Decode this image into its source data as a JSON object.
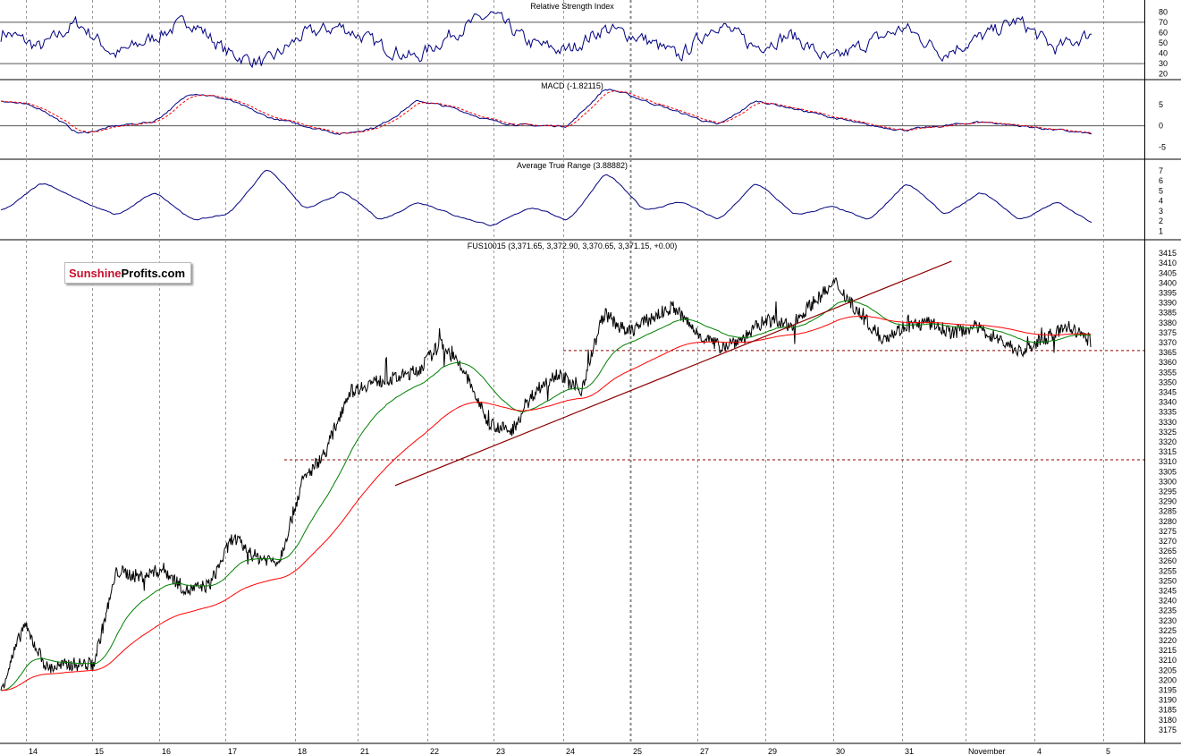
{
  "logo": {
    "part1": "Sunshine",
    "part2": "Profits.com"
  },
  "colors": {
    "price": "#000000",
    "ema_fast": "#008000",
    "ema_slow": "#ff0000",
    "indicator": "#000080",
    "macd_signal": "#ff0000",
    "trend": "#8b0000",
    "grid": "#9a9a9a"
  },
  "chart_data": [
    {
      "type": "line",
      "title": "Relative Strength Index",
      "yticks": [
        20,
        30,
        40,
        50,
        60,
        70,
        80
      ],
      "ylim": [
        18,
        88
      ],
      "reference_lines": [
        30,
        70
      ],
      "pattern": [
        62,
        45,
        70,
        38,
        55,
        72,
        40,
        30,
        58,
        66,
        48,
        35,
        60,
        78,
        50,
        42,
        64,
        55,
        36,
        70,
        46,
        58,
        32,
        50,
        65,
        40,
        55,
        72,
        44,
        60
      ]
    },
    {
      "type": "line",
      "title": "MACD (-1.82115)",
      "yticks": [
        -5,
        0,
        5
      ],
      "ylim": [
        -7,
        10
      ],
      "zero_line": 0,
      "pattern": [
        6,
        4,
        -2,
        0,
        1,
        8,
        6,
        2,
        0,
        -2,
        0,
        6,
        4,
        1,
        0,
        0,
        9,
        6,
        3,
        0,
        6,
        4,
        2,
        0,
        -1,
        0,
        1,
        0,
        -1,
        -2
      ]
    },
    {
      "type": "line",
      "title": "Average True Range (3.88882)",
      "yticks": [
        1,
        2,
        3,
        4,
        5,
        6,
        7
      ],
      "ylim": [
        0.5,
        7.8
      ],
      "pattern": [
        3,
        6,
        4,
        2.5,
        5,
        2,
        2.8,
        7.5,
        3,
        5,
        2,
        4,
        2.5,
        1.5,
        3.5,
        2,
        7,
        3,
        4,
        2,
        6,
        2.5,
        3.5,
        2,
        6,
        2.5,
        5,
        2,
        4,
        1.5
      ]
    },
    {
      "type": "line",
      "title": "FUS10015 (3,371.65, 3,372.90, 3,370.65, 3,371.15, +0.00)",
      "ylim": [
        3170,
        3420
      ],
      "ytick_step": 5,
      "x_labels": [
        "14",
        "15",
        "16",
        "17",
        "18",
        "21",
        "22",
        "23",
        "24",
        "25",
        "27",
        "29",
        "30",
        "31",
        "November",
        "4",
        "5"
      ],
      "price_anchors": [
        [
          0,
          3195
        ],
        [
          1,
          3228
        ],
        [
          2,
          3206
        ],
        [
          3,
          3208
        ],
        [
          4,
          3208
        ],
        [
          5,
          3255
        ],
        [
          6,
          3252
        ],
        [
          7,
          3256
        ],
        [
          8,
          3245
        ],
        [
          9,
          3248
        ],
        [
          10,
          3272
        ],
        [
          11,
          3262
        ],
        [
          12,
          3260
        ],
        [
          13,
          3300
        ],
        [
          14,
          3315
        ],
        [
          15,
          3345
        ],
        [
          16,
          3350
        ],
        [
          17,
          3352
        ],
        [
          18,
          3356
        ],
        [
          19,
          3370
        ],
        [
          20,
          3355
        ],
        [
          21,
          3330
        ],
        [
          22,
          3325
        ],
        [
          23,
          3345
        ],
        [
          24,
          3355
        ],
        [
          25,
          3345
        ],
        [
          26,
          3385
        ],
        [
          27,
          3375
        ],
        [
          28,
          3382
        ],
        [
          29,
          3388
        ],
        [
          30,
          3375
        ],
        [
          31,
          3368
        ],
        [
          32,
          3372
        ],
        [
          33,
          3382
        ],
        [
          34,
          3378
        ],
        [
          35,
          3390
        ],
        [
          36,
          3400
        ],
        [
          37,
          3385
        ],
        [
          38,
          3372
        ],
        [
          39,
          3378
        ],
        [
          40,
          3380
        ],
        [
          41,
          3375
        ],
        [
          42,
          3378
        ],
        [
          43,
          3372
        ],
        [
          44,
          3365
        ],
        [
          45,
          3372
        ],
        [
          46,
          3378
        ],
        [
          47,
          3371
        ]
      ],
      "horizontal_levels": [
        3366,
        3311
      ],
      "trend_line": {
        "start": [
          17,
          3298
        ],
        "end": [
          41,
          3411
        ]
      }
    }
  ]
}
